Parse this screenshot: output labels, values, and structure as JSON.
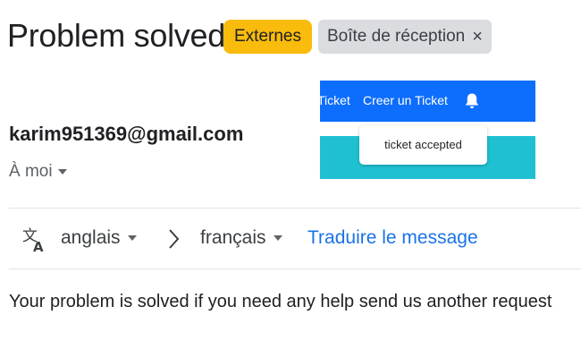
{
  "email": {
    "subject": "Problem solved",
    "labels": {
      "external": "Externes",
      "inbox": "Boîte de réception",
      "inbox_remove": "×"
    },
    "sender": "karim951369@gmail.com",
    "recipient": "À moi",
    "translate": {
      "source_language": "anglais",
      "target_language": "français",
      "action": "Traduire le message"
    },
    "body": "Your problem is solved if you need any help send us another request"
  },
  "ticket_app": {
    "nav_items": [
      "Ticket",
      "Creer un Ticket"
    ],
    "notification_icon": "bell-icon",
    "notification_text": "ticket accepted"
  },
  "colors": {
    "external_label": "#f9bb0c",
    "inbox_label": "#dadce0",
    "ticket_nav": "#0d6efd",
    "ticket_band": "#1fc0d1",
    "link": "#1a73e8"
  }
}
